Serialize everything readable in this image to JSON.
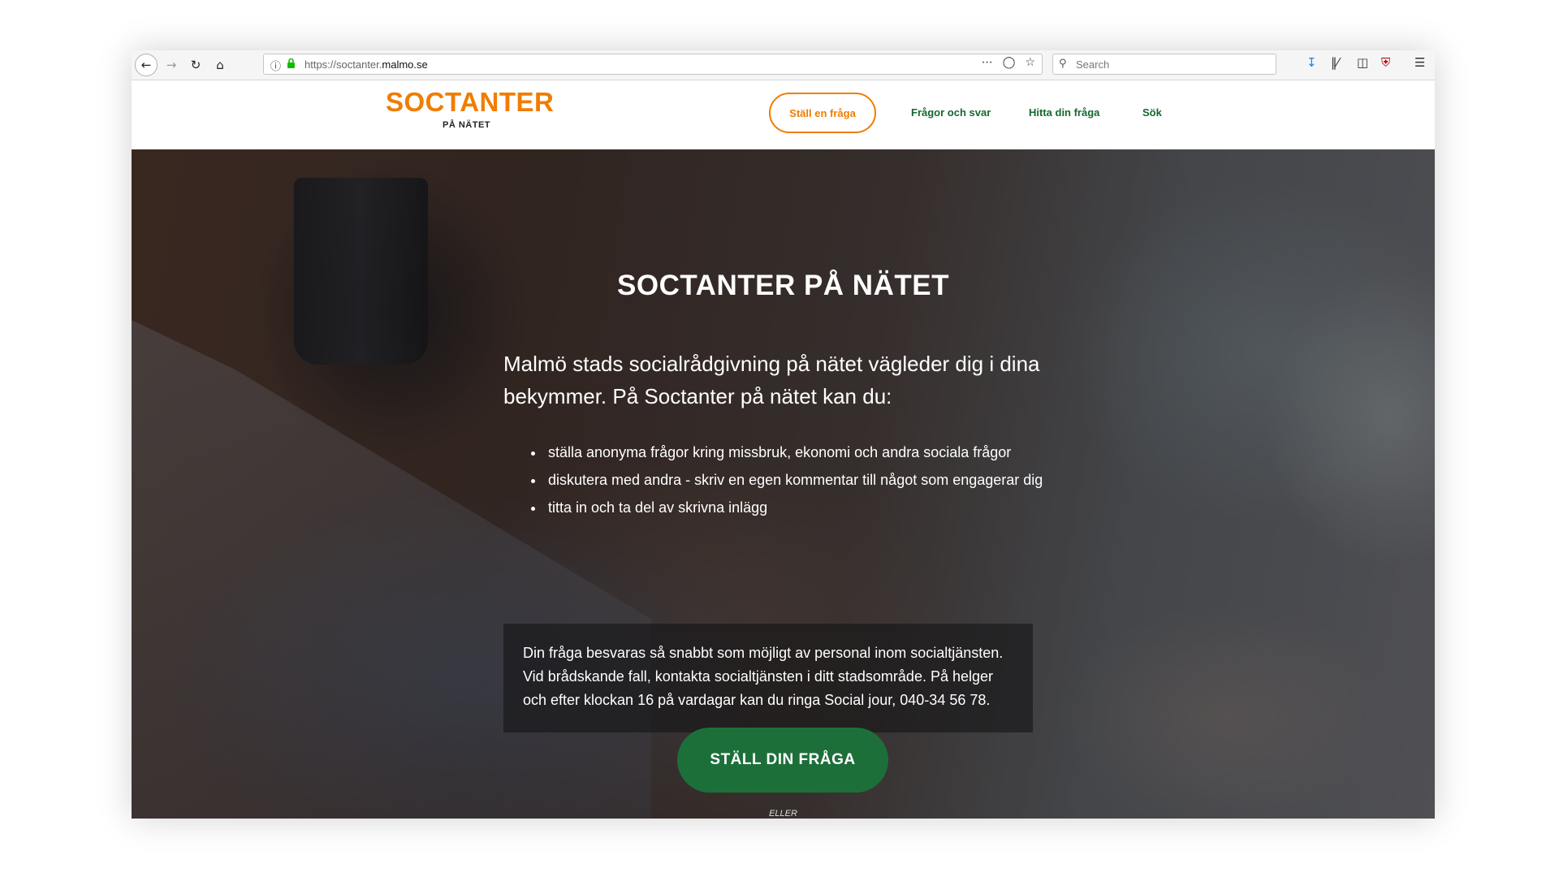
{
  "browser": {
    "url_prefix": "https://soctanter.",
    "url_domain": "malmo.se",
    "search_placeholder": "Search",
    "icons": {
      "back": "back-arrow-icon",
      "forward": "forward-arrow-icon",
      "reload": "reload-icon",
      "home": "home-icon",
      "info": "info-icon",
      "lock": "lock-icon",
      "more": "more-dots-icon",
      "pocket": "pocket-icon",
      "bookmark": "star-icon",
      "search": "search-icon",
      "download": "download-icon",
      "library": "library-icon",
      "sidebar": "sidebar-icon",
      "ublock": "shield-icon",
      "menu": "hamburger-menu-icon"
    }
  },
  "site": {
    "logo_main": "SOCTANTER",
    "logo_sub": "PÅ NÄTET",
    "nav": {
      "ask": "Ställ en fråga",
      "faq": "Frågor och svar",
      "find": "Hitta din fråga",
      "search": "Sök"
    },
    "colors": {
      "orange": "#f07d00",
      "green": "#15672f",
      "cta_green": "#1d6f3a"
    }
  },
  "hero": {
    "title": "SOCTANTER PÅ NÄTET",
    "lead": "Malmö stads socialrådgivning på nätet vägleder dig i dina bekymmer. På Soctanter på nätet kan du:",
    "bullets": [
      "ställa anonyma frågor kring missbruk, ekonomi och andra sociala frågor",
      "diskutera med andra - skriv en egen kommentar till något som engagerar dig",
      "titta in och ta del av skrivna inlägg"
    ],
    "info": "Din fråga besvaras så snabbt som möjligt av personal inom socialtjänsten. Vid brådskande fall, kontakta socialtjänsten i ditt stadsområde. På helger och efter klockan 16 på vardagar kan du ringa Social jour, 040-34 56 78.",
    "cta": "STÄLL DIN FRÅGA",
    "eller": "ELLER"
  }
}
